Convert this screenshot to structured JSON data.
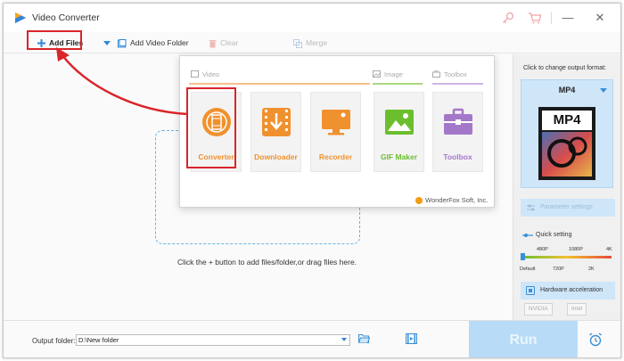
{
  "window": {
    "title": "Video Converter"
  },
  "toolbar": {
    "add_files": "Add Files",
    "add_video_folder": "Add Video Folder",
    "clear": "Clear",
    "merge": "Merge"
  },
  "popup": {
    "categories": {
      "video": "Video",
      "image": "Image",
      "toolbox": "Toolbox"
    },
    "tiles": [
      {
        "label": "Converter",
        "color": "#f0912f",
        "icon": "film-reel-icon"
      },
      {
        "label": "Downloader",
        "color": "#f0912f",
        "icon": "download-icon"
      },
      {
        "label": "Recorder",
        "color": "#f0912f",
        "icon": "monitor-record-icon"
      },
      {
        "label": "GIF Maker",
        "color": "#6bbf2f",
        "icon": "image-icon"
      },
      {
        "label": "Toolbox",
        "color": "#a478c9",
        "icon": "toolbox-icon"
      }
    ],
    "brand": "WonderFox Soft, Inc."
  },
  "main": {
    "drop_hint": "Click the + button to add files/folder,or drag files here."
  },
  "right_panel": {
    "click_to_change": "Click to change output format:",
    "format": "MP4",
    "format_thumb_text": "MP4",
    "parameter_settings": "Parameter settings",
    "quick_setting": "Quick setting",
    "quality_top": [
      "480P",
      "1080P",
      "4K"
    ],
    "quality_bottom": [
      "Default",
      "720P",
      "2K"
    ],
    "hardware_acceleration": "Hardware acceleration",
    "gpu_nvidia": "NVIDIA",
    "gpu_intel": "Intel"
  },
  "bottom": {
    "output_folder_label": "Output folder:",
    "output_folder_value": "D:\\New folder",
    "run": "Run"
  },
  "colors": {
    "accent": "#3a8fd6",
    "highlight_red": "#d9252a",
    "orange": "#f0912f",
    "green": "#6bbf2f",
    "purple": "#a478c9",
    "run_bg": "#b8dcf8"
  }
}
